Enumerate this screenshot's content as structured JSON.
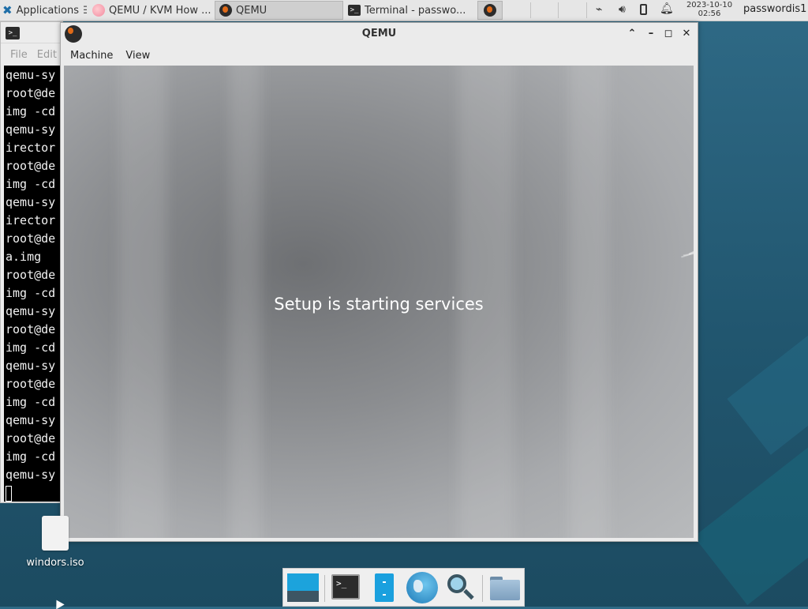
{
  "panel": {
    "applications_label": "Applications",
    "tasks": [
      {
        "label": "QEMU / KVM How ...",
        "icon": "browser-icon"
      },
      {
        "label": "QEMU",
        "icon": "qemu-icon"
      },
      {
        "label": "Terminal - passwo...",
        "icon": "terminal-icon"
      }
    ],
    "clock_date": "2023-10-10",
    "clock_time": "02:56",
    "username": "passwordis1"
  },
  "terminal": {
    "menu": [
      "File",
      "Edit"
    ],
    "lines": [
      "qemu-sy",
      "root@de",
      "img -cd",
      "qemu-sy",
      "irector",
      "root@de",
      "img -cd",
      "qemu-sy",
      "irector",
      "root@de",
      "a.img",
      "root@de",
      "img -cd",
      "qemu-sy",
      "root@de",
      "img -cd",
      "qemu-sy",
      "root@de",
      "img -cd",
      "qemu-sy",
      "root@de",
      "img -cd",
      "qemu-sy"
    ]
  },
  "qemu": {
    "title": "QEMU",
    "menu": [
      "Machine",
      "View"
    ],
    "screen_message": "Setup is starting services"
  },
  "desktop": {
    "icons": [
      {
        "label": "windors.iso"
      }
    ]
  },
  "dock": {
    "items": [
      "show-desktop-icon",
      "terminal-icon",
      "file-cabinet-icon",
      "web-browser-globe-icon",
      "search-magnifier-icon",
      "folder-icon"
    ]
  },
  "colors": {
    "desktop": "#2a6580",
    "panel": "#e6e6e6",
    "qemu_accent": "#e06a18"
  }
}
